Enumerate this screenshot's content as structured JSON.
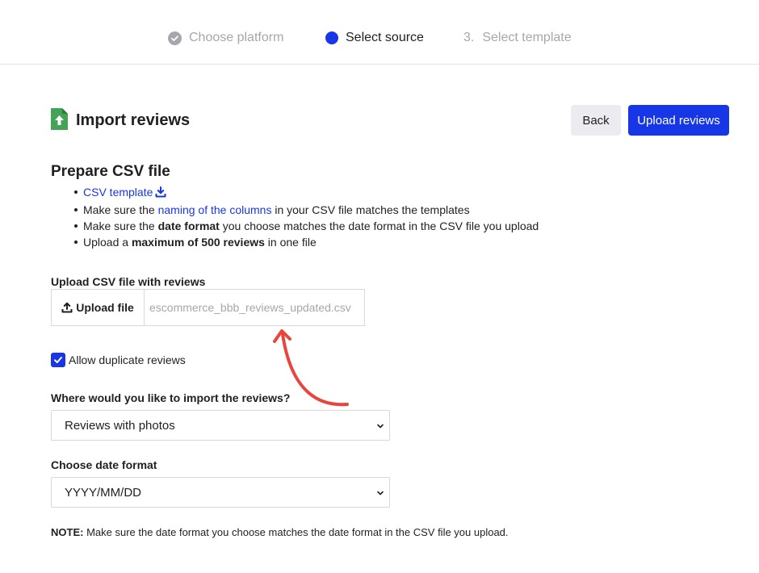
{
  "stepper": {
    "steps": [
      {
        "label": "Choose platform",
        "state": "done"
      },
      {
        "label": "Select source",
        "state": "active"
      },
      {
        "number": "3.",
        "label": "Select template",
        "state": "pending"
      }
    ]
  },
  "header": {
    "title": "Import reviews",
    "back_label": "Back",
    "upload_label": "Upload reviews"
  },
  "prepare": {
    "title": "Prepare CSV file",
    "bullet1_link": "CSV template",
    "bullet2_pre": "Make sure the ",
    "bullet2_link": "naming of the columns",
    "bullet2_post": " in your CSV file matches the templates",
    "bullet3_pre": "Make sure the ",
    "bullet3_bold": "date format",
    "bullet3_post": " you choose matches the date format in the CSV file you upload",
    "bullet4_pre": "Upload a ",
    "bullet4_bold": "maximum of 500 reviews",
    "bullet4_post": " in one file"
  },
  "upload": {
    "label": "Upload CSV file with reviews",
    "button_label": "Upload file",
    "file_name": "escommerce_bbb_reviews_updated.csv"
  },
  "duplicates": {
    "label": "Allow duplicate reviews",
    "checked": true
  },
  "destination": {
    "label": "Where would you like to import the reviews?",
    "selected": "Reviews with photos"
  },
  "date_format": {
    "label": "Choose date format",
    "selected": "YYYY/MM/DD"
  },
  "note": {
    "prefix": "NOTE:",
    "text": " Make sure the date format you choose matches the date format in the CSV file you upload."
  },
  "colors": {
    "accent": "#1737e6",
    "muted": "#a6a6ad",
    "annotation_arrow": "#e8453c",
    "icon_green": "#43a357"
  }
}
